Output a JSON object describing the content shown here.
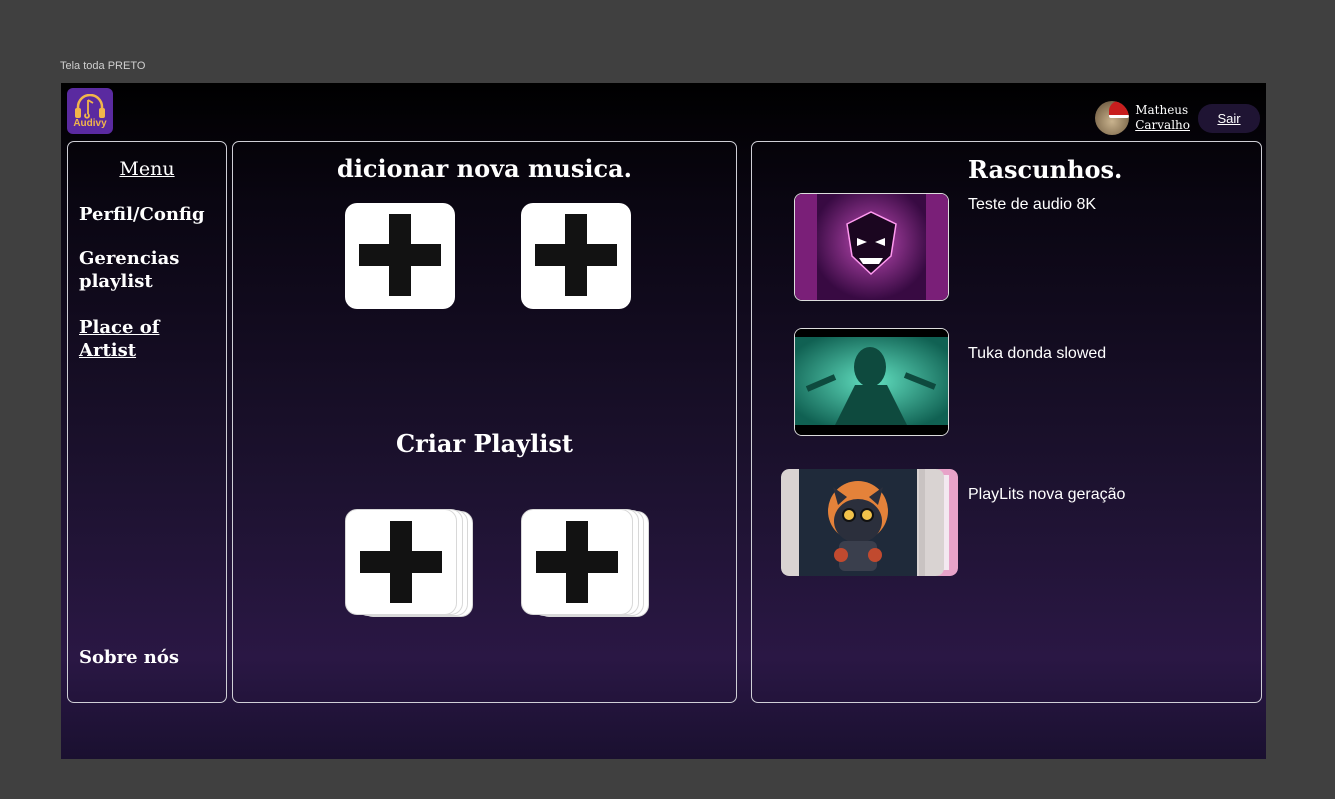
{
  "frame_label": "Tela toda PRETO",
  "logo": {
    "text": "Audivy"
  },
  "user": {
    "first_name": "Matheus",
    "last_name": "Carvalho"
  },
  "logout_label": "Sair",
  "menu": {
    "title": "Menu",
    "items": [
      {
        "label": "Perfil/Config"
      },
      {
        "label": "Gerencias playlist"
      },
      {
        "label": "Place of Artist"
      }
    ],
    "footer": "Sobre nós"
  },
  "center": {
    "add_music_title": "dicionar nova musica.",
    "create_playlist_title": "Criar Playlist"
  },
  "drafts": {
    "title": "Rascunhos.",
    "items": [
      {
        "label": "Teste de audio 8K"
      },
      {
        "label": "Tuka donda slowed"
      },
      {
        "label": "PlayLits nova geração"
      }
    ]
  },
  "colors": {
    "background": "#404040",
    "screen_top": "#000000",
    "screen_bottom": "#2a1744",
    "logo_bg": "#5a2aa0",
    "logo_accent": "#f2b64a",
    "logout_bg": "#1f1433"
  },
  "icons": [
    "headphones-music-logo",
    "plus-icon",
    "avatar",
    "thumbnail"
  ]
}
